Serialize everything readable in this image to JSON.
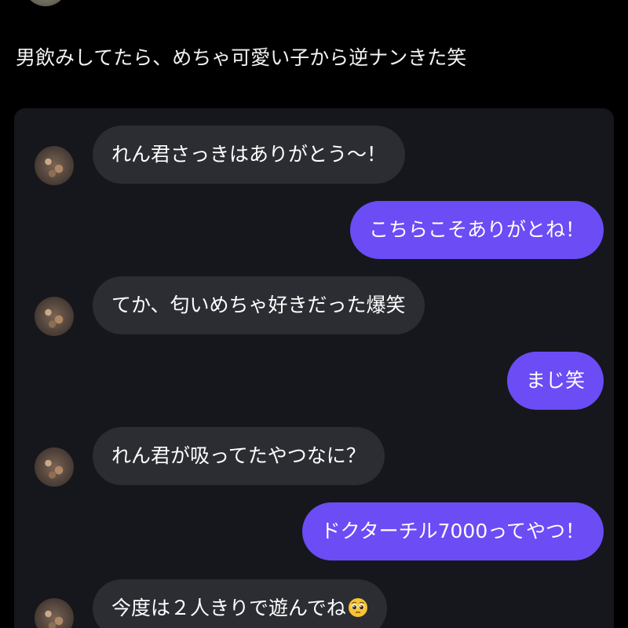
{
  "post": {
    "text": "男飲みしてたら、めちゃ可愛い子から逆ナンきた笑"
  },
  "messages": [
    {
      "direction": "incoming",
      "text": "れん君さっきはありがとう〜！"
    },
    {
      "direction": "outgoing",
      "text": "こちらこそありがとね！"
    },
    {
      "direction": "incoming",
      "text": "てか、匂いめちゃ好きだった爆笑"
    },
    {
      "direction": "outgoing",
      "text": "まじ笑"
    },
    {
      "direction": "incoming",
      "text": "れん君が吸ってたやつなに？"
    },
    {
      "direction": "outgoing",
      "text": "ドクターチル7000ってやつ！"
    },
    {
      "direction": "incoming",
      "text": "今度は２人きりで遊んでね",
      "emoji": "pleading-face-emoji"
    }
  ],
  "colors": {
    "background": "#000000",
    "card": "#15171c",
    "incoming_bubble": "#2b2d33",
    "outgoing_bubble": "#6b4cf5"
  }
}
